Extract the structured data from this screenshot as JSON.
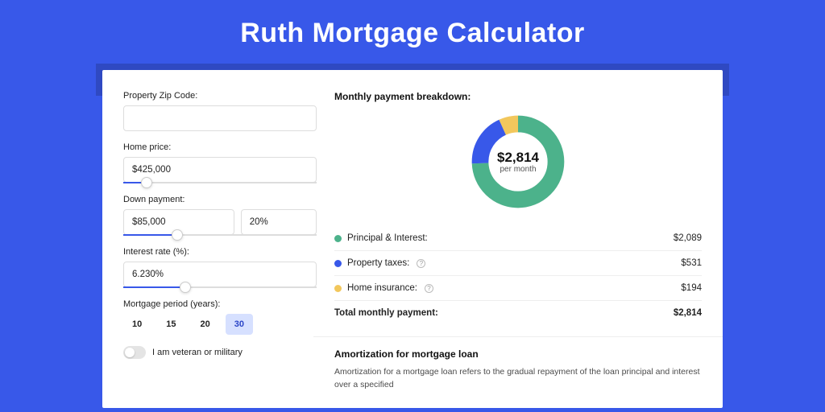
{
  "page": {
    "title": "Ruth Mortgage Calculator"
  },
  "form": {
    "zip": {
      "label": "Property Zip Code:",
      "value": ""
    },
    "home_price": {
      "label": "Home price:",
      "value": "$425,000",
      "slider_pct": 12
    },
    "down_payment": {
      "label": "Down payment:",
      "amount": "$85,000",
      "percent": "20%",
      "slider_pct": 28
    },
    "interest_rate": {
      "label": "Interest rate (%):",
      "value": "6.230%",
      "slider_pct": 32
    },
    "period": {
      "label": "Mortgage period (years):",
      "options": [
        "10",
        "15",
        "20",
        "30"
      ],
      "selected": "30"
    },
    "veteran": {
      "label": "I am veteran or military",
      "on": false
    }
  },
  "breakdown": {
    "title": "Monthly payment breakdown:",
    "center_amount": "$2,814",
    "center_sub": "per month",
    "rows": [
      {
        "label": "Principal & Interest:",
        "value": "$2,089",
        "color": "#4cb28b",
        "info": false
      },
      {
        "label": "Property taxes:",
        "value": "$531",
        "color": "#3858e9",
        "info": true
      },
      {
        "label": "Home insurance:",
        "value": "$194",
        "color": "#f2c75c",
        "info": true
      }
    ],
    "total": {
      "label": "Total monthly payment:",
      "value": "$2,814"
    }
  },
  "amortization": {
    "title": "Amortization for mortgage loan",
    "body": "Amortization for a mortgage loan refers to the gradual repayment of the loan principal and interest over a specified"
  },
  "chart_data": {
    "type": "pie",
    "title": "Monthly payment breakdown",
    "series": [
      {
        "name": "Principal & Interest",
        "value": 2089,
        "color": "#4cb28b"
      },
      {
        "name": "Property taxes",
        "value": 531,
        "color": "#3858e9"
      },
      {
        "name": "Home insurance",
        "value": 194,
        "color": "#f2c75c"
      }
    ],
    "total": 2814,
    "center_label": "$2,814 per month"
  }
}
